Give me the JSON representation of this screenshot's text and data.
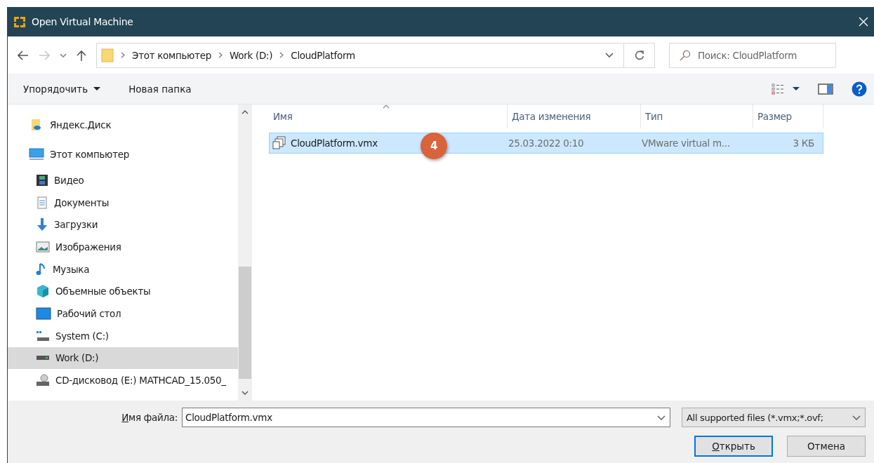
{
  "window": {
    "title": "Open Virtual Machine"
  },
  "address": {
    "segments": [
      "Этот компьютер",
      "Work (D:)",
      "CloudPlatform"
    ]
  },
  "search": {
    "placeholder": "Поиск: CloudPlatform"
  },
  "toolbar": {
    "organize": "Упорядочить",
    "new_folder": "Новая папка"
  },
  "sidebar": {
    "items": [
      {
        "label": "Яндекс.Диск",
        "kind": "cloud",
        "selected": false
      },
      {
        "label": "Этот компьютер",
        "kind": "computer",
        "selected": false,
        "children": [
          {
            "label": "Видео",
            "kind": "video",
            "selected": false
          },
          {
            "label": "Документы",
            "kind": "documents",
            "selected": false
          },
          {
            "label": "Загрузки",
            "kind": "downloads",
            "selected": false
          },
          {
            "label": "Изображения",
            "kind": "pictures",
            "selected": false
          },
          {
            "label": "Музыка",
            "kind": "music",
            "selected": false
          },
          {
            "label": "Объемные объекты",
            "kind": "objects",
            "selected": false
          },
          {
            "label": "Рабочий стол",
            "kind": "desktop",
            "selected": false
          },
          {
            "label": "System (C:)",
            "kind": "system-drive",
            "selected": false
          },
          {
            "label": "Work (D:)",
            "kind": "drive",
            "selected": true
          },
          {
            "label": "CD-дисковод (E:) MATHCAD_15.050_",
            "kind": "cd",
            "selected": false
          }
        ]
      }
    ]
  },
  "table": {
    "columns": [
      "Имя",
      "Дата изменения",
      "Тип",
      "Размер"
    ],
    "rows": [
      {
        "name": "CloudPlatform.vmx",
        "date": "25.03.2022 0:10",
        "type": "VMware virtual m...",
        "size": "3 КБ",
        "selected": true
      }
    ]
  },
  "step_badge": "4",
  "footer": {
    "filename_label": "Имя файла:",
    "filename": "CloudPlatform.vmx",
    "filter": "All supported files (*.vmx;*.ovf;",
    "open": "Открыть",
    "cancel": "Отмена"
  }
}
